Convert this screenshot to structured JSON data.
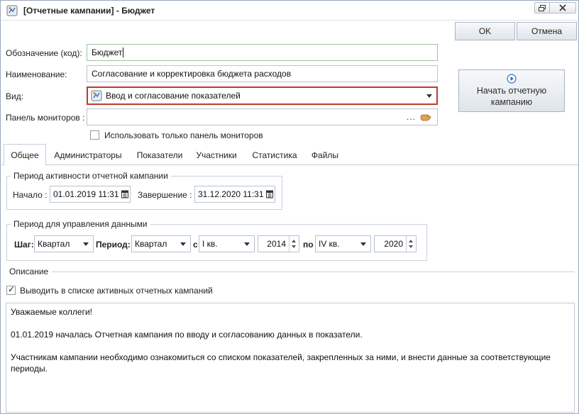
{
  "window": {
    "title": "[Отчетные кампании] - Бюджет"
  },
  "buttons": {
    "ok": "OK",
    "cancel": "Отмена",
    "start_campaign": "Начать отчетную кампанию"
  },
  "form": {
    "code_label": "Обозначение (код):",
    "code_value": "Бюджет",
    "name_label": "Наименование:",
    "name_value": "Согласование и корректировка бюджета расходов",
    "kind_label": "Вид:",
    "kind_value": "Ввод и согласование показателей",
    "monitors_label": "Панель мониторов :",
    "monitors_value": "",
    "monitors_ellipsis": "...",
    "only_monitors_label": "Использовать только панель мониторов",
    "only_monitors_checked": false
  },
  "tabs": [
    {
      "label": "Общее",
      "active": true
    },
    {
      "label": "Администраторы",
      "active": false
    },
    {
      "label": "Показатели",
      "active": false
    },
    {
      "label": "Участники",
      "active": false
    },
    {
      "label": "Статистика",
      "active": false
    },
    {
      "label": "Файлы",
      "active": false
    }
  ],
  "activity_period": {
    "title": "Период активности отчетной кампании",
    "start_label": "Начало :",
    "start_value": "01.01.2019 11:31",
    "end_label": "Завершение :",
    "end_value": "31.12.2020 11:31"
  },
  "data_period": {
    "title": "Период для управления данными",
    "step_label": "Шаг:",
    "step_value": "Квартал",
    "period_label": "Период:",
    "period_value": "Квартал",
    "from_label": "с",
    "from_quarter": "I кв.",
    "from_year": "2014",
    "to_label": "по",
    "to_quarter": "IV кв.",
    "to_year": "2020"
  },
  "description": {
    "title": "Описание",
    "show_active_label": "Выводить в списке активных отчетных кампаний",
    "show_active_checked": true,
    "line1": "Уважаемые коллеги!",
    "line2": "01.01.2019 началась Отчетная кампания по вводу и согласованию данных в показатели.",
    "line3": "Участникам кампании необходимо  ознакомиться со списком показателей, закрепленных за ними, и внести данные за соответствующие периоды."
  },
  "colors": {
    "highlight_border": "#c0392b",
    "accent_blue": "#2c6fb8"
  }
}
